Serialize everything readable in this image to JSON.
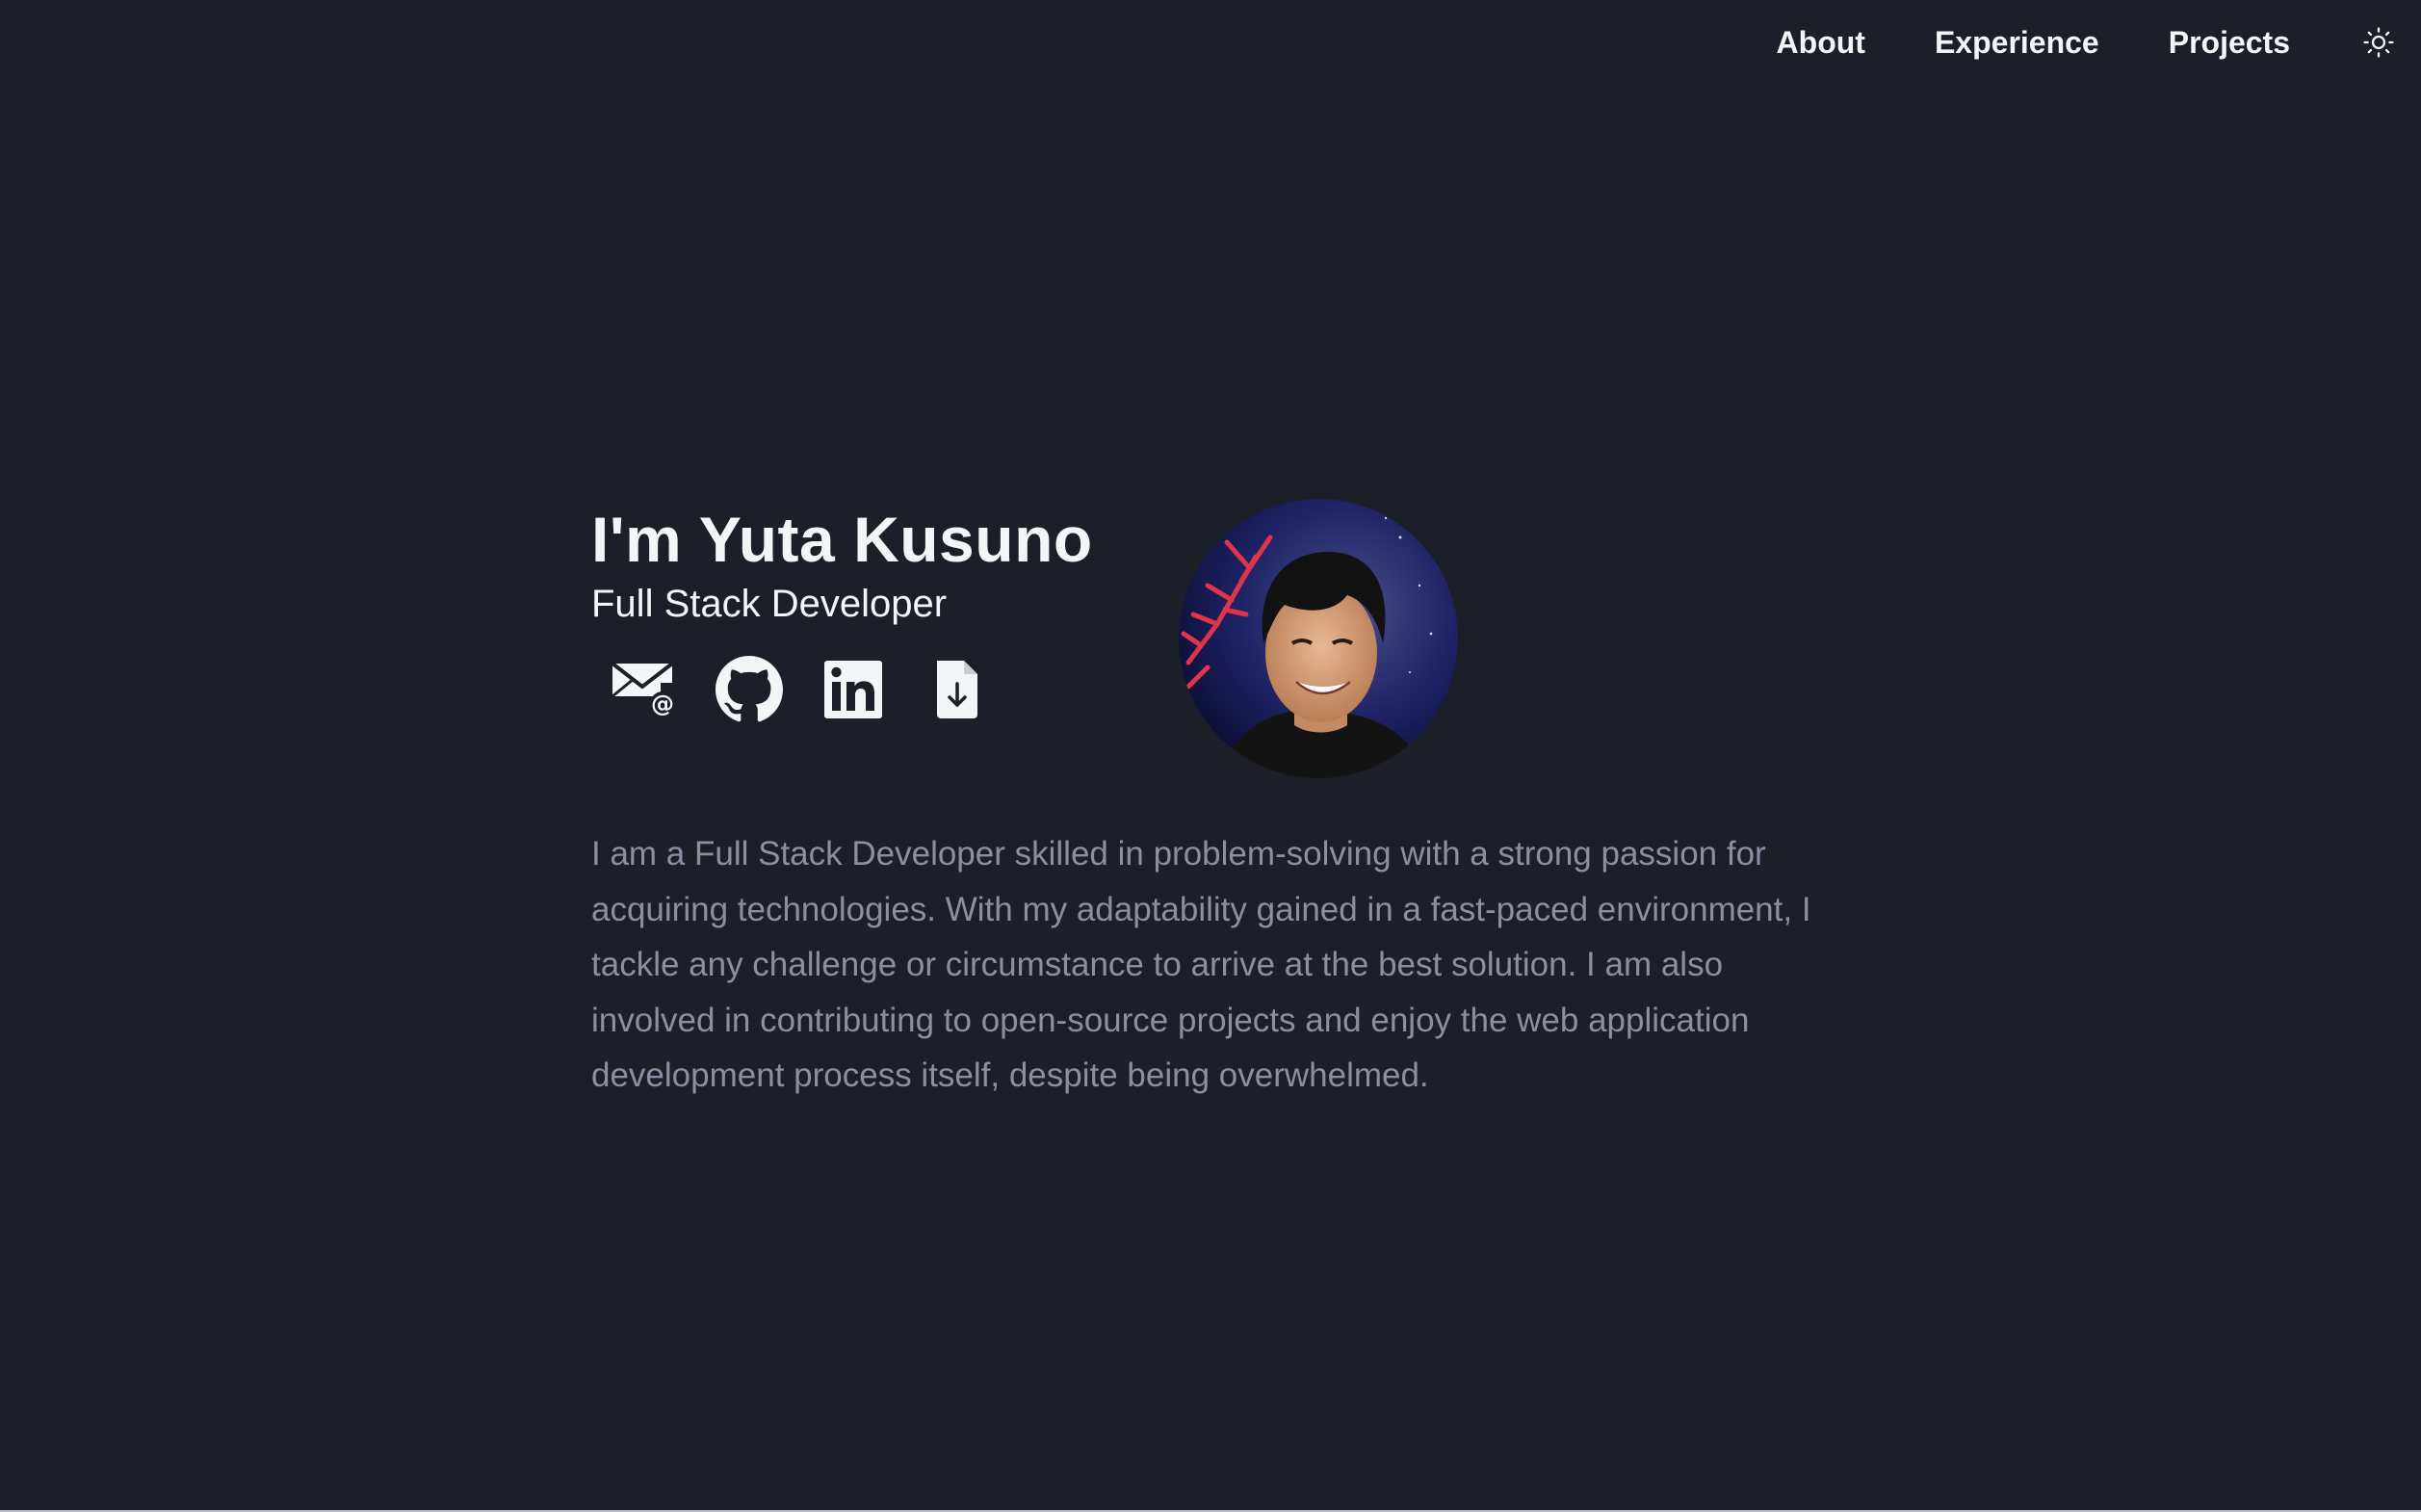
{
  "nav": {
    "links": [
      {
        "label": "About"
      },
      {
        "label": "Experience"
      },
      {
        "label": "Projects"
      }
    ],
    "theme_icon": "sun-icon"
  },
  "hero": {
    "title": "I'm Yuta Kusuno",
    "subtitle": "Full Stack Developer",
    "socials": [
      {
        "icon": "email-icon"
      },
      {
        "icon": "github-icon"
      },
      {
        "icon": "linkedin-icon"
      },
      {
        "icon": "resume-download-icon"
      }
    ],
    "bio": "I am a Full Stack Developer skilled in problem-solving with a strong passion for acquiring technologies. With my adaptability gained in a fast-paced environment, I tackle any challenge or circumstance to arrive at the best solution. I am also involved in contributing to open-source projects and enjoy the web application development process itself, despite being overwhelmed."
  },
  "colors": {
    "background": "#1d1f28",
    "text": "#f4f5f7",
    "muted_text": "#8a90a0"
  }
}
